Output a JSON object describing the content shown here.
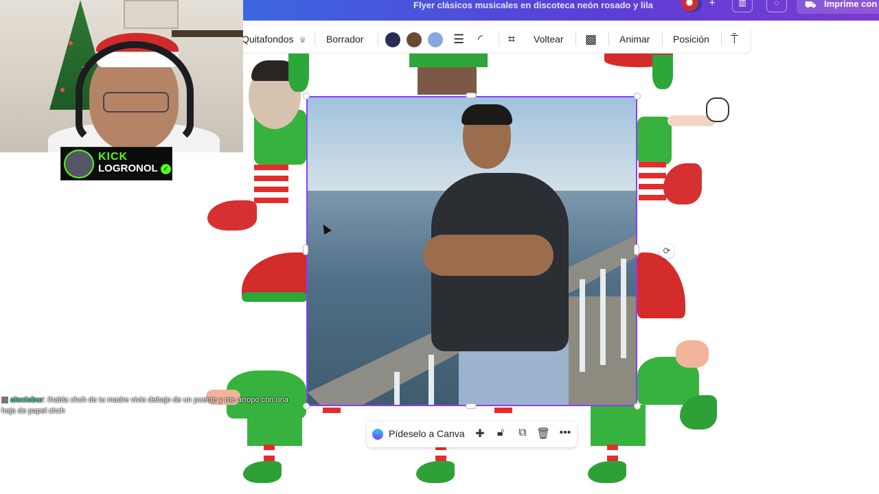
{
  "header": {
    "title": "Flyer clásicos musicales en discoteca neón rosado y lila",
    "print_label": "Imprime con"
  },
  "toolbar": {
    "bg_remover": "Quitafondos",
    "eraser": "Borrador",
    "flip": "Voltear",
    "animate": "Animar",
    "position": "Posición",
    "colors": [
      "#2a2d52",
      "#6b4a34",
      "#86a8dc"
    ]
  },
  "floatbar": {
    "ask_canva": "Pídeselo a Canva"
  },
  "stream": {
    "platform": "KICK",
    "channel": "LOGRONOL"
  },
  "chat": {
    "user": "alexisbur",
    "message": ": Ihabla chch de tu madre vivio debajo de un puente y me arropo con una hoja de papel chch"
  }
}
